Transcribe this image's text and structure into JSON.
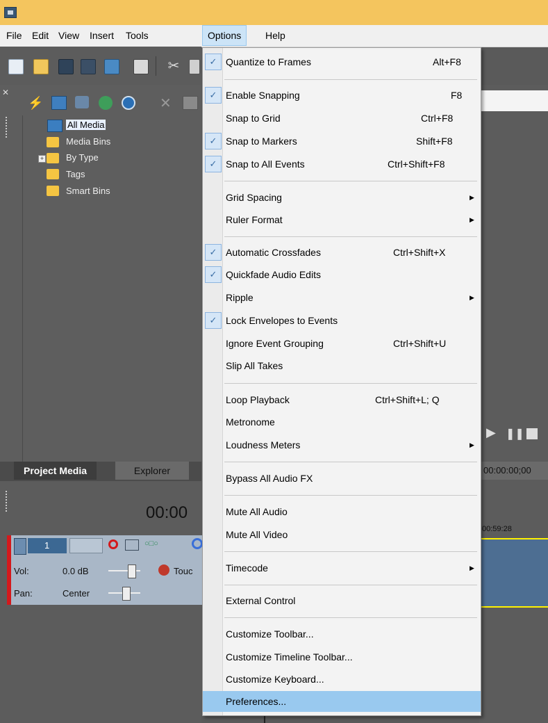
{
  "menubar": {
    "items": [
      "File",
      "Edit",
      "View",
      "Insert",
      "Tools",
      "Options",
      "Help"
    ]
  },
  "project_media": {
    "tree": [
      "All Media",
      "Media Bins",
      "By Type",
      "Tags",
      "Smart Bins"
    ]
  },
  "tabs": [
    "Project Media",
    "Explorer"
  ],
  "timeline": {
    "time": "00:00",
    "track_number": "1",
    "vol_label": "Vol:",
    "vol_value": "0.0 dB",
    "pan_label": "Pan:",
    "pan_value": "Center",
    "touch_label": "Touc",
    "timecode": "00:00:00;00",
    "ruler_mark": "00:59:28"
  },
  "options_menu": {
    "items": [
      {
        "label": "Quantize to Frames",
        "shortcut": "Alt+F8",
        "checked": true
      },
      {
        "label": "Enable Snapping",
        "shortcut": "F8",
        "checked": true
      },
      {
        "label": "Snap to Grid",
        "shortcut": "Ctrl+F8",
        "checked": false
      },
      {
        "label": "Snap to Markers",
        "shortcut": "Shift+F8",
        "checked": true
      },
      {
        "label": "Snap to All Events",
        "shortcut": "Ctrl+Shift+F8",
        "checked": true
      },
      {
        "label": "Grid Spacing",
        "shortcut": "",
        "checked": false,
        "submenu": true
      },
      {
        "label": "Ruler Format",
        "shortcut": "",
        "checked": false,
        "submenu": true
      },
      {
        "label": "Automatic Crossfades",
        "shortcut": "Ctrl+Shift+X",
        "checked": true
      },
      {
        "label": "Quickfade Audio Edits",
        "shortcut": "",
        "checked": true
      },
      {
        "label": "Ripple",
        "shortcut": "",
        "checked": false,
        "submenu": true
      },
      {
        "label": "Lock Envelopes to Events",
        "shortcut": "",
        "checked": true
      },
      {
        "label": "Ignore Event Grouping",
        "shortcut": "Ctrl+Shift+U",
        "checked": false
      },
      {
        "label": "Slip All Takes",
        "shortcut": "",
        "checked": false
      },
      {
        "label": "Loop Playback",
        "shortcut": "Ctrl+Shift+L; Q",
        "checked": false
      },
      {
        "label": "Metronome",
        "shortcut": "",
        "checked": false
      },
      {
        "label": "Loudness Meters",
        "shortcut": "",
        "checked": false,
        "submenu": true
      },
      {
        "label": "Bypass All Audio FX",
        "shortcut": "",
        "checked": false
      },
      {
        "label": "Mute All Audio",
        "shortcut": "",
        "checked": false
      },
      {
        "label": "Mute All Video",
        "shortcut": "",
        "checked": false
      },
      {
        "label": "Timecode",
        "shortcut": "",
        "checked": false,
        "submenu": true
      },
      {
        "label": "External Control",
        "shortcut": "",
        "checked": false
      },
      {
        "label": "Customize Toolbar...",
        "shortcut": "",
        "checked": false
      },
      {
        "label": "Customize Timeline Toolbar...",
        "shortcut": "",
        "checked": false
      },
      {
        "label": "Customize Keyboard...",
        "shortcut": "",
        "checked": false
      },
      {
        "label": "Preferences...",
        "shortcut": "",
        "checked": false,
        "highlighted": true
      }
    ]
  }
}
